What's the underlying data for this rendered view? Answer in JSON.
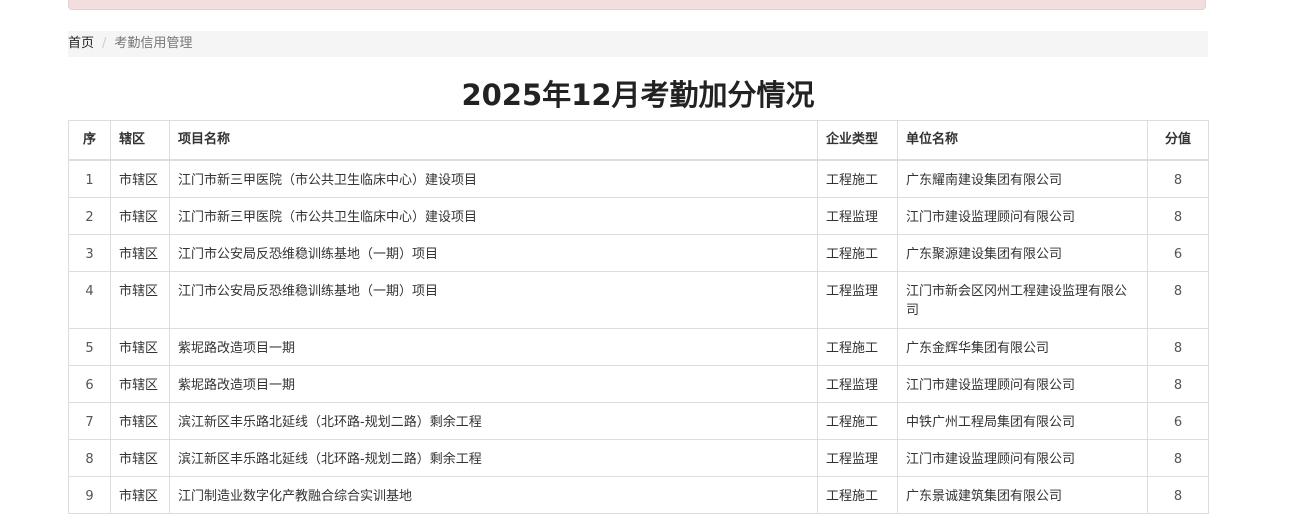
{
  "breadcrumb": {
    "home": "首页",
    "separator": "/",
    "current": "考勤信用管理"
  },
  "page_title": "2025年12月考勤加分情况",
  "table": {
    "headers": {
      "seq": "序",
      "district": "辖区",
      "project": "项目名称",
      "type": "企业类型",
      "company": "单位名称",
      "score": "分值"
    },
    "rows": [
      {
        "seq": "1",
        "district": "市辖区",
        "project": "江门市新三甲医院（市公共卫生临床中心）建设项目",
        "type": "工程施工",
        "company": "广东耀南建设集团有限公司",
        "score": "8"
      },
      {
        "seq": "2",
        "district": "市辖区",
        "project": "江门市新三甲医院（市公共卫生临床中心）建设项目",
        "type": "工程监理",
        "company": "江门市建设监理顾问有限公司",
        "score": "8"
      },
      {
        "seq": "3",
        "district": "市辖区",
        "project": "江门市公安局反恐维稳训练基地（一期）项目",
        "type": "工程施工",
        "company": "广东聚源建设集团有限公司",
        "score": "6"
      },
      {
        "seq": "4",
        "district": "市辖区",
        "project": "江门市公安局反恐维稳训练基地（一期）项目",
        "type": "工程监理",
        "company": "江门市新会区冈州工程建设监理有限公司",
        "score": "8"
      },
      {
        "seq": "5",
        "district": "市辖区",
        "project": "紫坭路改造项目一期",
        "type": "工程施工",
        "company": "广东金辉华集团有限公司",
        "score": "8"
      },
      {
        "seq": "6",
        "district": "市辖区",
        "project": "紫坭路改造项目一期",
        "type": "工程监理",
        "company": "江门市建设监理顾问有限公司",
        "score": "8"
      },
      {
        "seq": "7",
        "district": "市辖区",
        "project": "滨江新区丰乐路北延线（北环路-规划二路）剩余工程",
        "type": "工程施工",
        "company": "中铁广州工程局集团有限公司",
        "score": "6"
      },
      {
        "seq": "8",
        "district": "市辖区",
        "project": "滨江新区丰乐路北延线（北环路-规划二路）剩余工程",
        "type": "工程监理",
        "company": "江门市建设监理顾问有限公司",
        "score": "8"
      },
      {
        "seq": "9",
        "district": "市辖区",
        "project": "江门制造业数字化产教融合综合实训基地",
        "type": "工程施工",
        "company": "广东景诚建筑集团有限公司",
        "score": "8"
      }
    ]
  }
}
